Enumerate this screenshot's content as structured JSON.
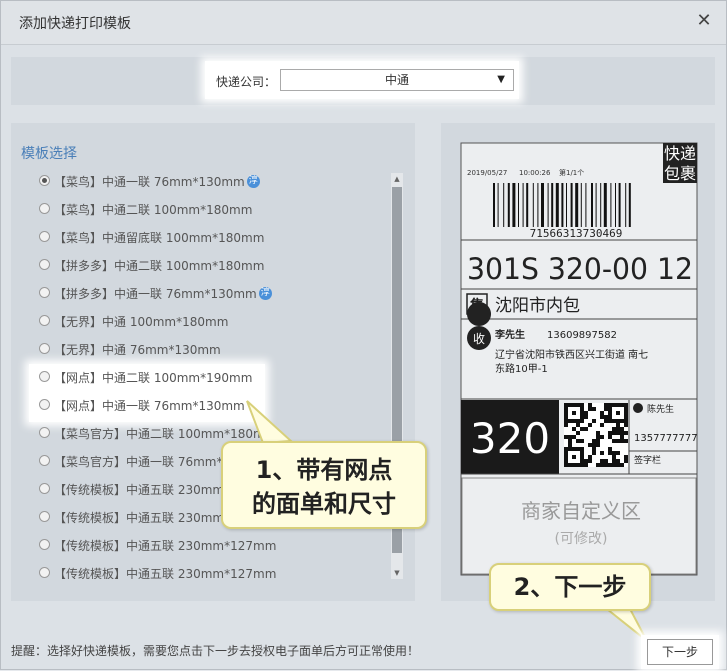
{
  "dialog": {
    "title": "添加快递打印模板",
    "close_glyph": "✕"
  },
  "company": {
    "label": "快递公司：",
    "selected": "中通",
    "arrow_glyph": "▼"
  },
  "template_section": {
    "title": "模板选择",
    "items": [
      {
        "label": "【菜鸟】中通一联 76mm*130mm",
        "checked": true,
        "tag": "淳"
      },
      {
        "label": "【菜鸟】中通二联 100mm*180mm",
        "checked": false
      },
      {
        "label": "【菜鸟】中通留底联 100mm*180mm",
        "checked": false
      },
      {
        "label": "【拼多多】中通二联 100mm*180mm",
        "checked": false
      },
      {
        "label": "【拼多多】中通一联 76mm*130mm",
        "checked": false,
        "tag": "淳"
      },
      {
        "label": "【无界】中通 100mm*180mm",
        "checked": false
      },
      {
        "label": "【无界】中通 76mm*130mm",
        "checked": false
      },
      {
        "label": "【网点】中通二联 100mm*190mm",
        "checked": false
      },
      {
        "label": "【网点】中通一联 76mm*130mm",
        "checked": false
      },
      {
        "label": "【菜鸟官方】中通二联 100mm*180mm",
        "checked": false
      },
      {
        "label": "【菜鸟官方】中通一联 76mm*130mm",
        "checked": false
      },
      {
        "label": "【传统模板】中通五联 230mm*127mm",
        "checked": false
      },
      {
        "label": "【传统模板】中通五联 230mm*127mm",
        "checked": false
      },
      {
        "label": "【传统模板】中通五联 230mm*127mm",
        "checked": false
      },
      {
        "label": "【传统模板】中通五联 230mm*127mm",
        "checked": false
      }
    ]
  },
  "preview": {
    "corner_badge_line1": "快递",
    "corner_badge_line2": "包裹",
    "date": "2019/05/27",
    "time": "10:00:26",
    "page": "第1/1个",
    "tracking_number": "71566313730469",
    "route_code": "301S  320-00  12",
    "collect_badge": "集",
    "collect_city": "沈阳市内包",
    "receive_badge": "收",
    "receiver_name": "李先生",
    "receiver_phone": "13609897582",
    "address_line1": "辽宁省沈阳市铁西区兴工街道 南七",
    "address_line2": "东路10甲-1",
    "big_code": "320",
    "sender_name": "陈先生",
    "sender_phone": "1357777777",
    "sign_label": "签字栏",
    "custom_area": "商家自定义区",
    "custom_note": "(可修改)"
  },
  "footer": {
    "hint": "提醒：选择好快递模板，需要您点击下一步去授权电子面单后方可正常使用！",
    "next_label": "下一步"
  },
  "callouts": {
    "first_line1": "1、带有网点",
    "first_line2": "的面单和尺寸",
    "second": "2、下一步"
  },
  "colors": {
    "accent_blue": "#4a7fb8",
    "callout_bg": "#fffde0",
    "callout_border": "#d8d07a"
  }
}
